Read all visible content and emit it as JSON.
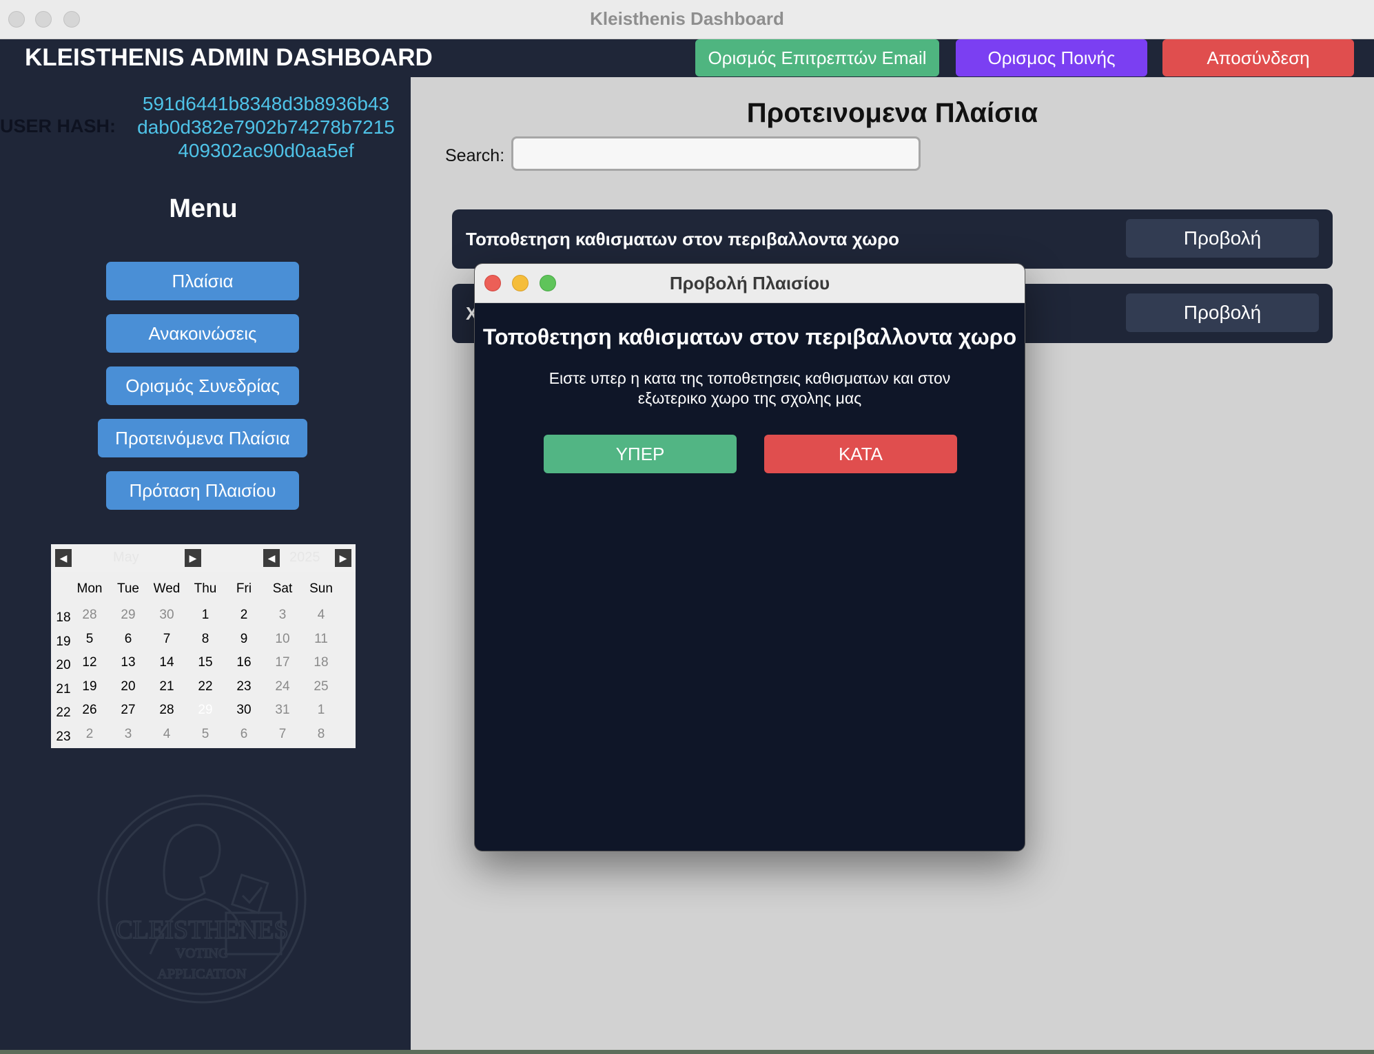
{
  "window": {
    "title": "Kleisthenis Dashboard"
  },
  "header": {
    "title": "KLEISTHENIS ADMIN DASHBOARD",
    "buttons": [
      {
        "label": "Ορισμός Επιτρεπτών Email",
        "color": "#4fb580"
      },
      {
        "label": "Ορισμος Ποινής",
        "color": "#7b3ff2"
      },
      {
        "label": "Αποσύνδεση",
        "color": "#e04e4e"
      }
    ]
  },
  "sidebar": {
    "user_hash_label": "USER HASH:",
    "user_hash_lines": [
      "591d6441b8348d3b8936b43",
      "dab0d382e7902b74278b7215",
      "409302ac90d0aa5ef"
    ],
    "menu_title": "Menu",
    "menu_items": [
      {
        "label": "Πλαίσια"
      },
      {
        "label": "Ανακοινώσεις"
      },
      {
        "label": "Ορισμός Συνεδρίας"
      },
      {
        "label": "Προτεινόμενα Πλαίσια"
      },
      {
        "label": "Πρόταση Πλαισίου"
      }
    ],
    "calendar": {
      "month": "May",
      "year": "2025",
      "weekdays": [
        "Mon",
        "Tue",
        "Wed",
        "Thu",
        "Fri",
        "Sat",
        "Sun"
      ],
      "weeks": [
        {
          "week": "18",
          "days": [
            "28",
            "29",
            "30",
            "1",
            "2",
            "3",
            "4"
          ]
        },
        {
          "week": "19",
          "days": [
            "5",
            "6",
            "7",
            "8",
            "9",
            "10",
            "11"
          ]
        },
        {
          "week": "20",
          "days": [
            "12",
            "13",
            "14",
            "15",
            "16",
            "17",
            "18"
          ]
        },
        {
          "week": "21",
          "days": [
            "19",
            "20",
            "21",
            "22",
            "23",
            "24",
            "25"
          ]
        },
        {
          "week": "22",
          "days": [
            "26",
            "27",
            "28",
            "29",
            "30",
            "31",
            "1"
          ]
        },
        {
          "week": "23",
          "days": [
            "2",
            "3",
            "4",
            "5",
            "6",
            "7",
            "8"
          ]
        }
      ],
      "today": "29"
    },
    "logo": {
      "name": "CLEISTHENES",
      "line2": "VOTING",
      "line3": "APPLICATION"
    }
  },
  "main": {
    "title": "Προτεινομενα Πλαίσια",
    "search_label": "Search:",
    "search_value": "",
    "cards": [
      {
        "title": "Τοποθετηση καθισματων στον περιβαλλοντα χωρο",
        "button": "Προβολή"
      },
      {
        "title": "Χ",
        "button": "Προβολή"
      }
    ]
  },
  "dialog": {
    "title": "Προβολή Πλαισίου",
    "heading": "Τοποθετηση καθισματων στον περιβαλλοντα χωρο",
    "description": "Ειστε υπερ η κατα της τοποθετησεις καθισματων και στον εξωτερικο χωρο της σχολης μας",
    "for_label": "ΥΠΕΡ",
    "against_label": "ΚΑΤΑ",
    "for_color": "#52b584",
    "against_color": "#e04e4e"
  }
}
